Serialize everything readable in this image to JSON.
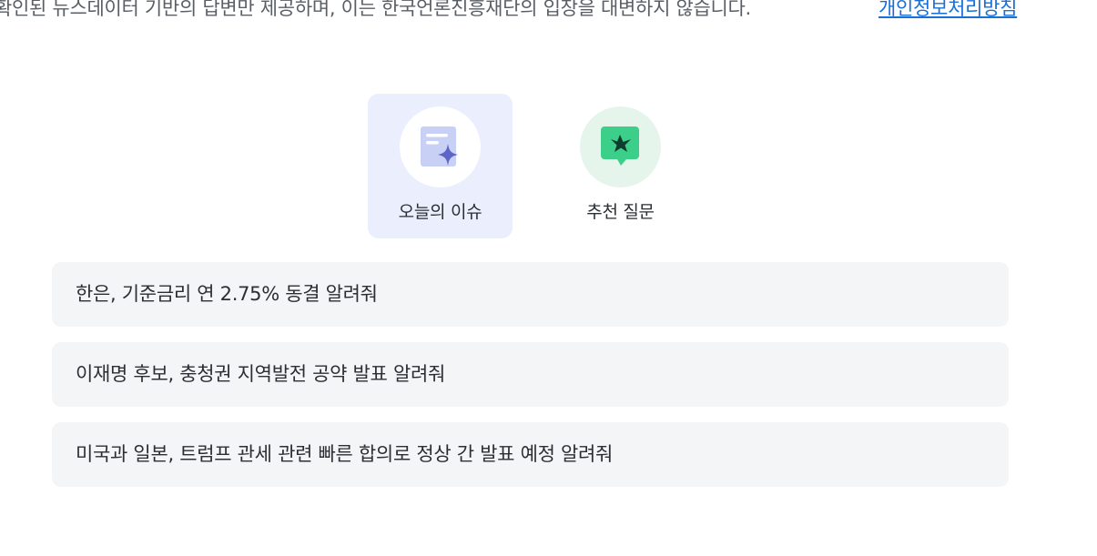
{
  "footer": {
    "disclaimer": "확인된 뉴스데이터 기반의 답변만 제공하며, 이는 한국언론진흥재단의 입장을 대변하지 않습니다.",
    "privacy_link": "개인정보처리방침"
  },
  "tabs": [
    {
      "label": "오늘의 이슈",
      "icon": "document-sparkle-icon",
      "active": true,
      "accent": "#6b78d8"
    },
    {
      "label": "추천 질문",
      "icon": "chat-sparkle-icon",
      "active": false,
      "accent": "#2bbf7a"
    }
  ],
  "questions": [
    {
      "text": "한은, 기준금리 연 2.75% 동결 알려줘"
    },
    {
      "text": "이재명 후보, 충청권 지역발전 공약 발표 알려줘"
    },
    {
      "text": "미국과 일본, 트럼프 관세 관련 빠른 합의로 정상 간 발표 예정 알려줘"
    }
  ]
}
